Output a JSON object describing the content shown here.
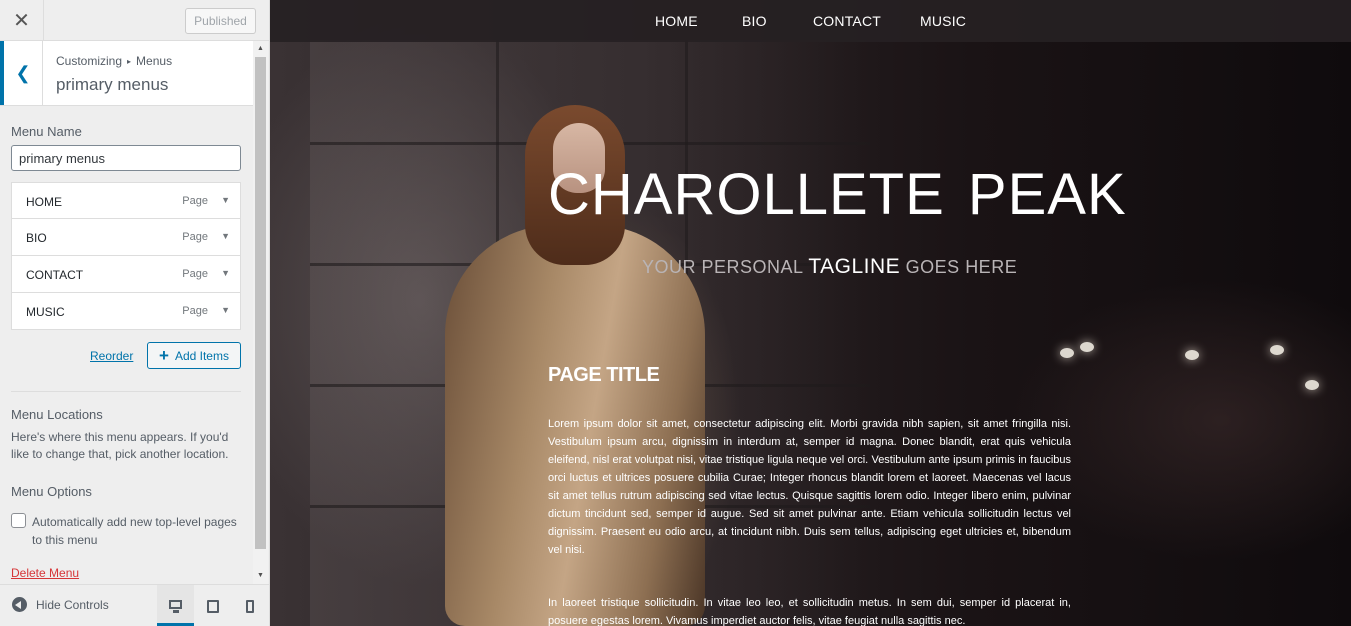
{
  "customizer": {
    "header": {
      "published_label": "Published"
    },
    "section": {
      "breadcrumb_root": "Customizing",
      "breadcrumb_sep": "▸",
      "breadcrumb_parent": "Menus",
      "title": "primary menus"
    },
    "menu_name": {
      "label": "Menu Name",
      "value": "primary menus"
    },
    "menu_items": [
      {
        "title": "HOME",
        "type": "Page"
      },
      {
        "title": "BIO",
        "type": "Page"
      },
      {
        "title": "CONTACT",
        "type": "Page"
      },
      {
        "title": "MUSIC",
        "type": "Page"
      }
    ],
    "reorder_label": "Reorder",
    "add_items_label": "Add Items",
    "locations": {
      "heading": "Menu Locations",
      "description": "Here's where this menu appears. If you'd like to change that, pick another location."
    },
    "options": {
      "heading": "Menu Options",
      "auto_add_label": "Automatically add new top-level pages to this menu",
      "auto_add_checked": false
    },
    "delete_label": "Delete Menu",
    "footer": {
      "hide_controls_label": "Hide Controls",
      "active_device": "desktop"
    }
  },
  "preview": {
    "nav": [
      "HOME",
      "BIO",
      "CONTACT",
      "MUSIC"
    ],
    "site_title": "CHAROLLETE PEAK",
    "tagline_pre": "YOUR PERSONAL ",
    "tagline_strong": "TAGLINE",
    "tagline_post": " GOES HERE",
    "page_title": "PAGE TITLE",
    "paragraph_1": "Lorem ipsum dolor sit amet, consectetur adipiscing elit. Morbi gravida nibh sapien, sit amet fringilla nisi. Vestibulum ipsum arcu, dignissim in interdum at, semper id magna. Donec blandit, erat quis vehicula eleifend, nisl erat volutpat nisi, vitae tristique ligula neque vel orci. Vestibulum ante ipsum primis in faucibus orci luctus et ultrices posuere cubilia Curae; Integer rhoncus blandit lorem et laoreet. Maecenas vel lacus sit amet tellus rutrum adipiscing sed vitae lectus. Quisque sagittis lorem odio. Integer libero enim, pulvinar dictum tincidunt sed, semper id augue. Sed sit amet pulvinar ante. Etiam vehicula sollicitudin lectus vel dignissim. Praesent eu odio arcu, at tincidunt nibh. Duis sem tellus, adipiscing eget ultricies et, bibendum vel nisi.",
    "paragraph_2": "In laoreet tristique sollicitudin. In vitae leo leo, et sollicitudin metus. In sem dui, semper id placerat in, posuere egestas lorem. Vivamus imperdiet auctor felis, vitae feugiat nulla sagittis nec.",
    "colors": {
      "accent": "#0073aa",
      "delete": "#d63638"
    }
  }
}
